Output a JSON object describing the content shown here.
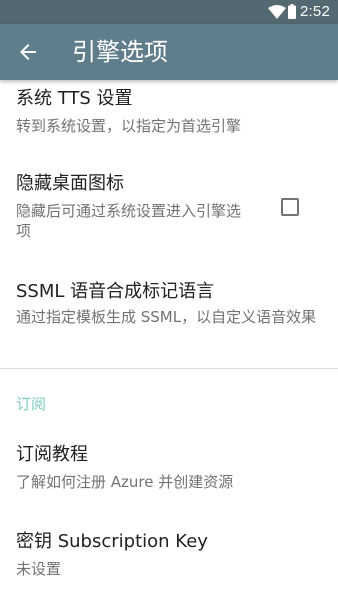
{
  "status_bar": {
    "time": "2:52",
    "wifi_icon": "wifi-full-icon",
    "battery_icon": "battery-icon"
  },
  "app_bar": {
    "back_icon": "arrow-back-icon",
    "title": "引擎选项",
    "color": "#607d8b"
  },
  "preferences": [
    {
      "title": "系统 TTS 设置",
      "summary": "转到系统设置，以指定为首选引擎"
    },
    {
      "title": "隐藏桌面图标",
      "summary": "隐藏后可通过系统设置进入引擎选项",
      "checked": false
    },
    {
      "title": "SSML 语音合成标记语言",
      "summary": "通过指定模板生成 SSML，以自定义语音效果"
    }
  ],
  "category": {
    "label": "订阅",
    "color": "#80cbc4"
  },
  "subscription_prefs": [
    {
      "title": "订阅教程",
      "summary": "了解如何注册 Azure 并创建资源"
    },
    {
      "title": "密钥 Subscription Key",
      "summary": "未设置"
    }
  ]
}
